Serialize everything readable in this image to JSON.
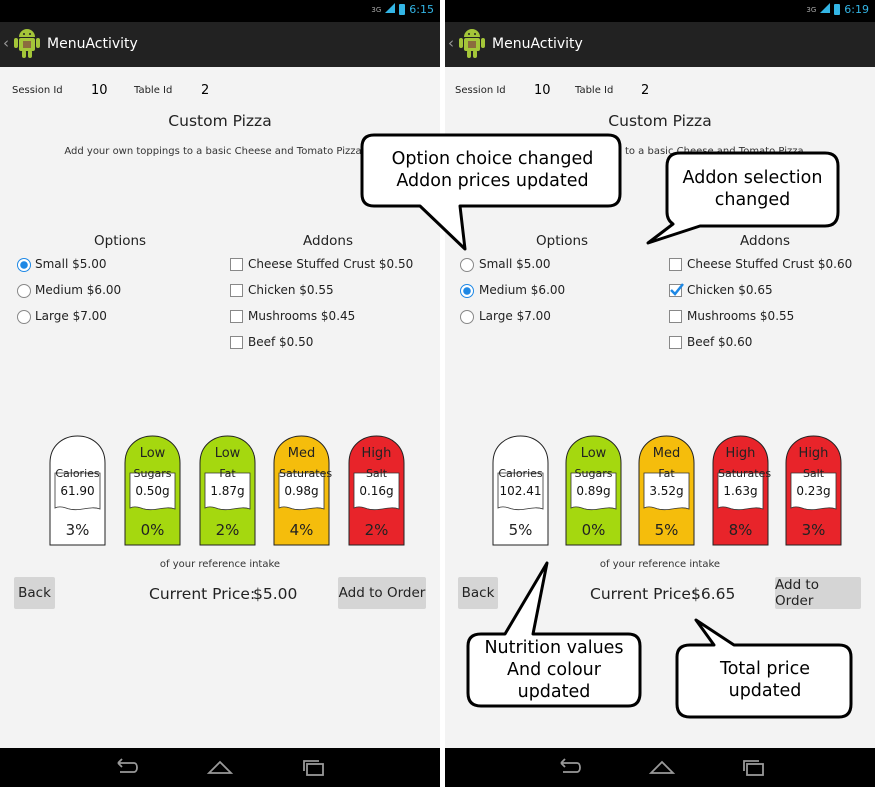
{
  "screens": [
    {
      "status_time": "6:15",
      "network": "3G",
      "app_title": "MenuActivity",
      "session_label": "Session Id",
      "session_value": "10",
      "table_label": "Table Id",
      "table_value": "2",
      "pizza_title": "Custom Pizza",
      "pizza_desc": "Add your own toppings to a basic Cheese and Tomato Pizza",
      "options_header": "Options",
      "addons_header": "Addons",
      "options": [
        {
          "label": "Small $5.00",
          "selected": true
        },
        {
          "label": "Medium $6.00",
          "selected": false
        },
        {
          "label": "Large $7.00",
          "selected": false
        }
      ],
      "addons": [
        {
          "label": "Cheese Stuffed Crust $0.50",
          "checked": false
        },
        {
          "label": "Chicken $0.55",
          "checked": false
        },
        {
          "label": "Mushrooms $0.45",
          "checked": false
        },
        {
          "label": "Beef $0.50",
          "checked": false
        }
      ],
      "nutrition": [
        {
          "level": "",
          "name": "Calories",
          "value": "61.90",
          "percent": "3%",
          "color": "#ffffff"
        },
        {
          "level": "Low",
          "name": "Sugars",
          "value": "0.50g",
          "percent": "0%",
          "color": "#a5d80f"
        },
        {
          "level": "Low",
          "name": "Fat",
          "value": "1.87g",
          "percent": "2%",
          "color": "#a5d80f"
        },
        {
          "level": "Med",
          "name": "Saturates",
          "value": "0.98g",
          "percent": "4%",
          "color": "#f5bd0c"
        },
        {
          "level": "High",
          "name": "Salt",
          "value": "0.16g",
          "percent": "2%",
          "color": "#e8242a"
        }
      ],
      "reference_note": "of your reference intake",
      "back_label": "Back",
      "price_label": "Current Price:",
      "price_value": "$5.00",
      "add_label": "Add to Order"
    },
    {
      "status_time": "6:19",
      "network": "3G",
      "app_title": "MenuActivity",
      "session_label": "Session Id",
      "session_value": "10",
      "table_label": "Table Id",
      "table_value": "2",
      "pizza_title": "Custom Pizza",
      "pizza_desc": "Add your own toppings to a basic Cheese and Tomato Pizza",
      "options_header": "Options",
      "addons_header": "Addons",
      "options": [
        {
          "label": "Small $5.00",
          "selected": false
        },
        {
          "label": "Medium $6.00",
          "selected": true
        },
        {
          "label": "Large $7.00",
          "selected": false
        }
      ],
      "addons": [
        {
          "label": "Cheese Stuffed Crust $0.60",
          "checked": false
        },
        {
          "label": "Chicken $0.65",
          "checked": true
        },
        {
          "label": "Mushrooms $0.55",
          "checked": false
        },
        {
          "label": "Beef $0.60",
          "checked": false
        }
      ],
      "nutrition": [
        {
          "level": "",
          "name": "Calories",
          "value": "102.41",
          "percent": "5%",
          "color": "#ffffff"
        },
        {
          "level": "Low",
          "name": "Sugars",
          "value": "0.89g",
          "percent": "0%",
          "color": "#a5d80f"
        },
        {
          "level": "Med",
          "name": "Fat",
          "value": "3.52g",
          "percent": "5%",
          "color": "#f5bd0c"
        },
        {
          "level": "High",
          "name": "Saturates",
          "value": "1.63g",
          "percent": "8%",
          "color": "#e8242a"
        },
        {
          "level": "High",
          "name": "Salt",
          "value": "0.23g",
          "percent": "3%",
          "color": "#e8242a"
        }
      ],
      "reference_note": "of your reference intake",
      "back_label": "Back",
      "price_label": "Current Price:",
      "price_value": "$6.65",
      "add_label": "Add to Order"
    }
  ],
  "callouts": {
    "option_change": [
      "Option choice changed",
      "Addon prices updated"
    ],
    "addon_change": [
      "Addon selection",
      "changed"
    ],
    "nutrition_change": [
      "Nutrition values",
      "And colour",
      "updated"
    ],
    "price_change": [
      "Total price",
      "updated"
    ]
  }
}
